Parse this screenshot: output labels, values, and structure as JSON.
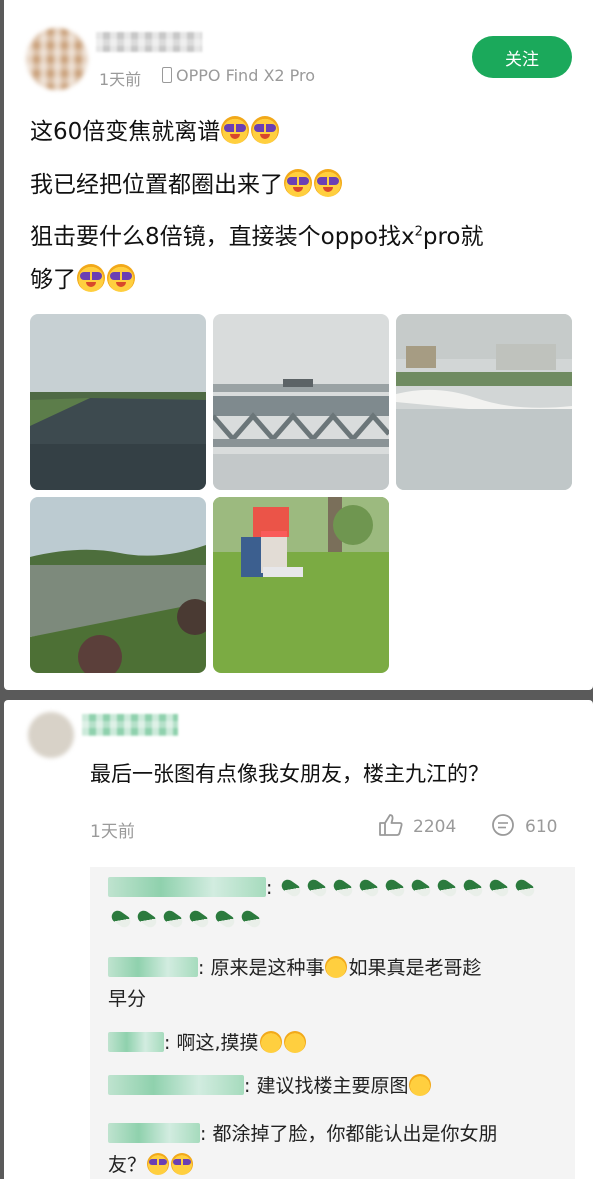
{
  "post": {
    "author_time": "1天前",
    "device_label": "OPPO Find X2 Pro",
    "follow_label": "关注",
    "lines": [
      "这60倍变焦就离谱",
      "我已经把位置都圈出来了",
      "狙击要什么8倍镜，直接装个oppo找x",
      "pro就",
      "够了"
    ],
    "superscript": "2",
    "photos": [
      "river-1",
      "bridge",
      "shore",
      "pond",
      "lawn-couple"
    ]
  },
  "comment": {
    "text": "最后一张图有点像我女朋友，楼主九江的？",
    "time": "1天前",
    "likes": "2204",
    "replies_count": "610"
  },
  "replies": [
    {
      "sep": ":",
      "text": ""
    },
    {
      "sep": ":",
      "text": "原来是这种事",
      "text2": "如果真是老哥趁",
      "text3": "早分"
    },
    {
      "sep": ":",
      "text": "啊这,摸摸"
    },
    {
      "sep": ":",
      "text": "建议找楼主要原图"
    },
    {
      "sep": ":",
      "text": "都涂掉了脸，你都能认出是你女朋",
      "text2": "友？"
    }
  ],
  "colors": {
    "accent": "#1ba95b",
    "muted": "#9a9a9a",
    "reply_bg": "#f4f4f4"
  }
}
